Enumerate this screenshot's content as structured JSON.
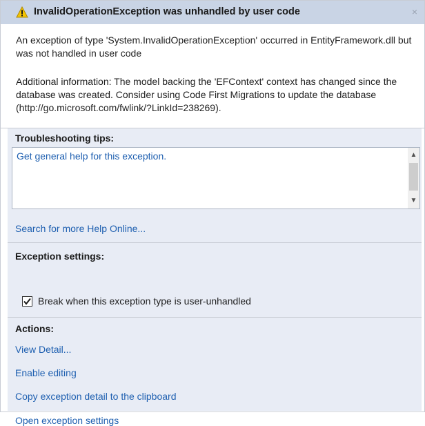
{
  "dialog": {
    "title": "InvalidOperationException was unhandled by user code",
    "close_glyph": "×",
    "message": "An exception of type 'System.InvalidOperationException' occurred in EntityFramework.dll but was not handled in user code",
    "additional_info": "Additional information: The model backing the 'EFContext' context has changed since the database was created. Consider using Code First Migrations to update the database (http://go.microsoft.com/fwlink/?LinkId=238269).",
    "icon": "warning-triangle-icon",
    "colors": {
      "title_bar": "#c9d4e5",
      "panel": "#e8ecf5",
      "link": "#1e5fb0",
      "warning": "#f5c400"
    }
  },
  "troubleshooting": {
    "heading": "Troubleshooting tips:",
    "tips": [
      "Get general help for this exception."
    ],
    "search_link": "Search for more Help Online..."
  },
  "exception_settings": {
    "heading": "Exception settings:",
    "checkbox_label": "Break when this exception type is user-unhandled",
    "checked": true
  },
  "actions": {
    "heading": "Actions:",
    "items": [
      "View Detail...",
      "Enable editing",
      "Copy exception detail to the clipboard",
      "Open exception settings"
    ]
  }
}
